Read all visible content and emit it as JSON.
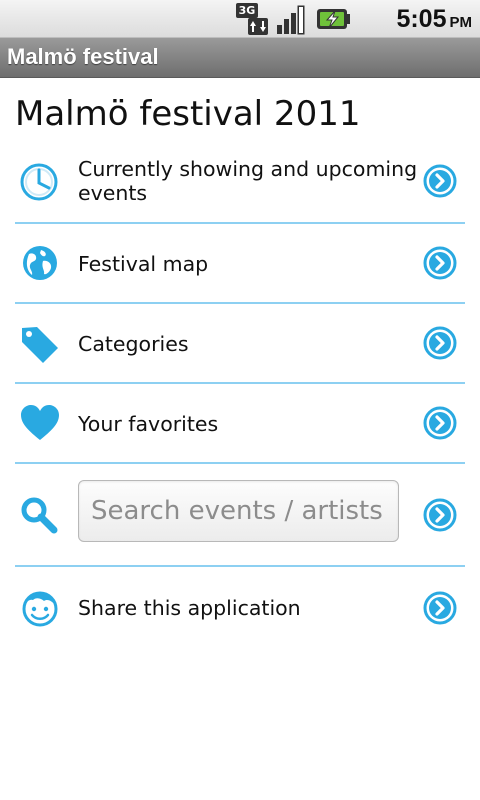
{
  "status_bar": {
    "network": "3G",
    "time": "5:05",
    "ampm": "PM"
  },
  "app_title": "Malmö festival",
  "page_title": "Malmö festival 2011",
  "menu": {
    "current_events_line1": "Currently showing and upcoming",
    "current_events_line2": "events",
    "festival_map": "Festival map",
    "categories": "Categories",
    "favorites": "Your favorites",
    "share": "Share this application"
  },
  "search": {
    "placeholder": "Search events / artists"
  },
  "colors": {
    "accent": "#29a9e1",
    "divider": "#8dd0f2"
  },
  "icons": [
    "clock-icon",
    "globe-icon",
    "tag-icon",
    "heart-icon",
    "search-icon",
    "smiley-icon",
    "chevron-right-circle-icon"
  ]
}
